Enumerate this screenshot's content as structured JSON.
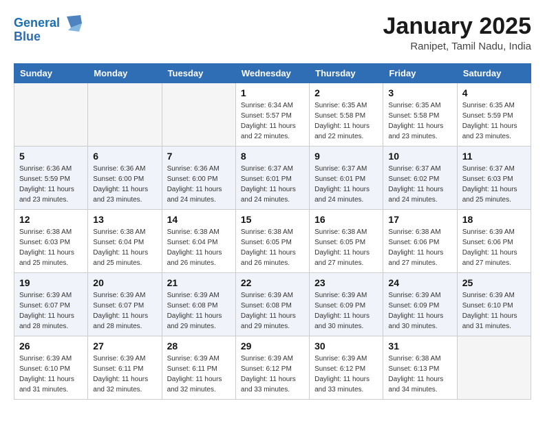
{
  "header": {
    "logo_line1": "General",
    "logo_line2": "Blue",
    "month": "January 2025",
    "location": "Ranipet, Tamil Nadu, India"
  },
  "days_of_week": [
    "Sunday",
    "Monday",
    "Tuesday",
    "Wednesday",
    "Thursday",
    "Friday",
    "Saturday"
  ],
  "weeks": [
    [
      {
        "day": "",
        "info": ""
      },
      {
        "day": "",
        "info": ""
      },
      {
        "day": "",
        "info": ""
      },
      {
        "day": "1",
        "info": "Sunrise: 6:34 AM\nSunset: 5:57 PM\nDaylight: 11 hours\nand 22 minutes."
      },
      {
        "day": "2",
        "info": "Sunrise: 6:35 AM\nSunset: 5:58 PM\nDaylight: 11 hours\nand 22 minutes."
      },
      {
        "day": "3",
        "info": "Sunrise: 6:35 AM\nSunset: 5:58 PM\nDaylight: 11 hours\nand 23 minutes."
      },
      {
        "day": "4",
        "info": "Sunrise: 6:35 AM\nSunset: 5:59 PM\nDaylight: 11 hours\nand 23 minutes."
      }
    ],
    [
      {
        "day": "5",
        "info": "Sunrise: 6:36 AM\nSunset: 5:59 PM\nDaylight: 11 hours\nand 23 minutes."
      },
      {
        "day": "6",
        "info": "Sunrise: 6:36 AM\nSunset: 6:00 PM\nDaylight: 11 hours\nand 23 minutes."
      },
      {
        "day": "7",
        "info": "Sunrise: 6:36 AM\nSunset: 6:00 PM\nDaylight: 11 hours\nand 24 minutes."
      },
      {
        "day": "8",
        "info": "Sunrise: 6:37 AM\nSunset: 6:01 PM\nDaylight: 11 hours\nand 24 minutes."
      },
      {
        "day": "9",
        "info": "Sunrise: 6:37 AM\nSunset: 6:01 PM\nDaylight: 11 hours\nand 24 minutes."
      },
      {
        "day": "10",
        "info": "Sunrise: 6:37 AM\nSunset: 6:02 PM\nDaylight: 11 hours\nand 24 minutes."
      },
      {
        "day": "11",
        "info": "Sunrise: 6:37 AM\nSunset: 6:03 PM\nDaylight: 11 hours\nand 25 minutes."
      }
    ],
    [
      {
        "day": "12",
        "info": "Sunrise: 6:38 AM\nSunset: 6:03 PM\nDaylight: 11 hours\nand 25 minutes."
      },
      {
        "day": "13",
        "info": "Sunrise: 6:38 AM\nSunset: 6:04 PM\nDaylight: 11 hours\nand 25 minutes."
      },
      {
        "day": "14",
        "info": "Sunrise: 6:38 AM\nSunset: 6:04 PM\nDaylight: 11 hours\nand 26 minutes."
      },
      {
        "day": "15",
        "info": "Sunrise: 6:38 AM\nSunset: 6:05 PM\nDaylight: 11 hours\nand 26 minutes."
      },
      {
        "day": "16",
        "info": "Sunrise: 6:38 AM\nSunset: 6:05 PM\nDaylight: 11 hours\nand 27 minutes."
      },
      {
        "day": "17",
        "info": "Sunrise: 6:38 AM\nSunset: 6:06 PM\nDaylight: 11 hours\nand 27 minutes."
      },
      {
        "day": "18",
        "info": "Sunrise: 6:39 AM\nSunset: 6:06 PM\nDaylight: 11 hours\nand 27 minutes."
      }
    ],
    [
      {
        "day": "19",
        "info": "Sunrise: 6:39 AM\nSunset: 6:07 PM\nDaylight: 11 hours\nand 28 minutes."
      },
      {
        "day": "20",
        "info": "Sunrise: 6:39 AM\nSunset: 6:07 PM\nDaylight: 11 hours\nand 28 minutes."
      },
      {
        "day": "21",
        "info": "Sunrise: 6:39 AM\nSunset: 6:08 PM\nDaylight: 11 hours\nand 29 minutes."
      },
      {
        "day": "22",
        "info": "Sunrise: 6:39 AM\nSunset: 6:08 PM\nDaylight: 11 hours\nand 29 minutes."
      },
      {
        "day": "23",
        "info": "Sunrise: 6:39 AM\nSunset: 6:09 PM\nDaylight: 11 hours\nand 30 minutes."
      },
      {
        "day": "24",
        "info": "Sunrise: 6:39 AM\nSunset: 6:09 PM\nDaylight: 11 hours\nand 30 minutes."
      },
      {
        "day": "25",
        "info": "Sunrise: 6:39 AM\nSunset: 6:10 PM\nDaylight: 11 hours\nand 31 minutes."
      }
    ],
    [
      {
        "day": "26",
        "info": "Sunrise: 6:39 AM\nSunset: 6:10 PM\nDaylight: 11 hours\nand 31 minutes."
      },
      {
        "day": "27",
        "info": "Sunrise: 6:39 AM\nSunset: 6:11 PM\nDaylight: 11 hours\nand 32 minutes."
      },
      {
        "day": "28",
        "info": "Sunrise: 6:39 AM\nSunset: 6:11 PM\nDaylight: 11 hours\nand 32 minutes."
      },
      {
        "day": "29",
        "info": "Sunrise: 6:39 AM\nSunset: 6:12 PM\nDaylight: 11 hours\nand 33 minutes."
      },
      {
        "day": "30",
        "info": "Sunrise: 6:39 AM\nSunset: 6:12 PM\nDaylight: 11 hours\nand 33 minutes."
      },
      {
        "day": "31",
        "info": "Sunrise: 6:38 AM\nSunset: 6:13 PM\nDaylight: 11 hours\nand 34 minutes."
      },
      {
        "day": "",
        "info": ""
      }
    ]
  ]
}
